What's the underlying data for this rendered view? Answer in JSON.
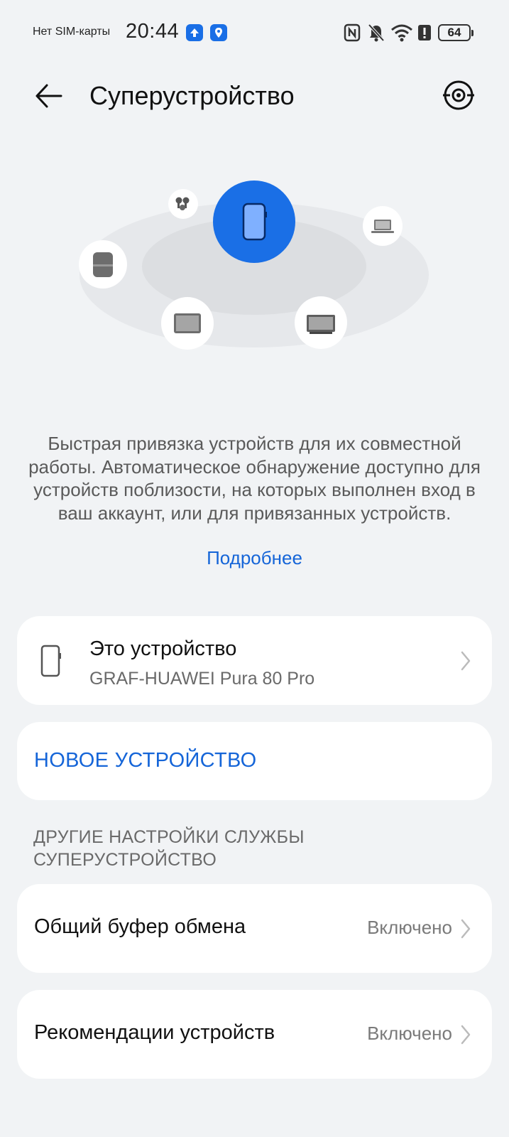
{
  "status_bar": {
    "carrier": "Нет SIM-карты",
    "time": "20:44",
    "battery": "64",
    "icons": [
      "app-update-icon",
      "location-app-icon",
      "nfc-icon",
      "bell-muted-icon",
      "wifi-icon",
      "alert-icon",
      "battery-icon"
    ]
  },
  "header": {
    "title": "Суперустройство",
    "back_icon": "back-arrow-icon",
    "action_icon": "radar-scan-icon"
  },
  "hero": {
    "center_device": "phone-icon",
    "devices": [
      "earbuds-icon",
      "speaker-icon",
      "tablet-icon",
      "monitor-icon",
      "laptop-icon"
    ],
    "accent_color": "#1a6fe6"
  },
  "description": "Быстрая привязка устройств для их совместной работы. Автоматическое обнаружение доступно для устройств поблизости, на которых выполнен вход в ваш аккаунт, или для привязанных устройств.",
  "more_link": "Подробнее",
  "this_device": {
    "title": "Это устройство",
    "model": "GRAF-HUAWEI Pura 80 Pro"
  },
  "new_device": {
    "label": "НОВОЕ УСТРОЙСТВО"
  },
  "other_settings": {
    "header": "ДРУГИЕ НАСТРОЙКИ СЛУЖБЫ СУПЕРУСТРОЙСТВО",
    "items": [
      {
        "label": "Общий буфер обмена",
        "value": "Включено"
      },
      {
        "label": "Рекомендации устройств",
        "value": "Включено"
      }
    ]
  },
  "colors": {
    "background": "#f1f3f5",
    "card": "#ffffff",
    "link": "#1565d8"
  }
}
